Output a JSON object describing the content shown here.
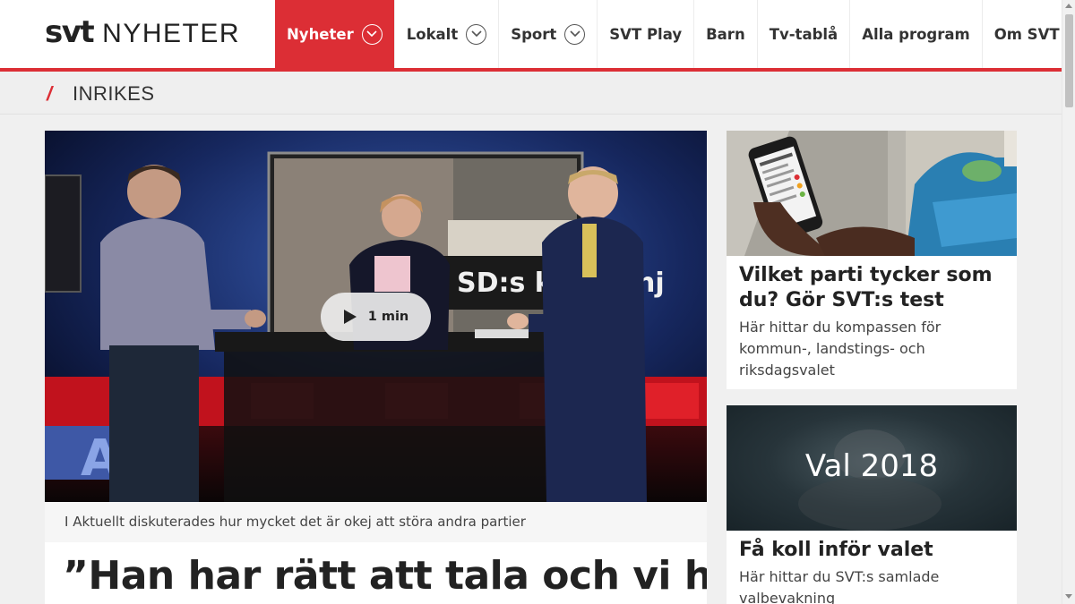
{
  "header": {
    "logo_svt": "svt",
    "logo_nyheter": "NYHETER",
    "nav": [
      {
        "label": "Nyheter",
        "active": true,
        "dropdown": true
      },
      {
        "label": "Lokalt",
        "active": false,
        "dropdown": true
      },
      {
        "label": "Sport",
        "active": false,
        "dropdown": true
      },
      {
        "label": "SVT Play",
        "active": false,
        "dropdown": false
      },
      {
        "label": "Barn",
        "active": false,
        "dropdown": false
      },
      {
        "label": "Tv-tablå",
        "active": false,
        "dropdown": false
      },
      {
        "label": "Alla program",
        "active": false,
        "dropdown": false
      },
      {
        "label": "Om SVT",
        "active": false,
        "dropdown": false
      }
    ]
  },
  "section": {
    "slash": "/",
    "title": "INRIKES"
  },
  "main_article": {
    "video_duration": "1 min",
    "caption": "I Aktuellt diskuterades hur mycket det är okej att störa andra partier",
    "headline": "”Han har rätt att tala och vi har",
    "video_overlay_text": "SD:s kampanj"
  },
  "cards": [
    {
      "title": "Vilket parti tycker som du? Gör SVT:s test",
      "desc": "Här hittar du kompassen för kommun-, landstings- och riksdagsvalet"
    },
    {
      "image_text": "Val 2018",
      "title": "Få koll inför valet",
      "desc": "Här hittar du SVT:s samlade valbevakning"
    }
  ],
  "colors": {
    "accent": "#dc2e35",
    "background": "#f0f0f0"
  },
  "icons": {
    "play": "play-icon",
    "chevron": "chevron-down-icon"
  }
}
